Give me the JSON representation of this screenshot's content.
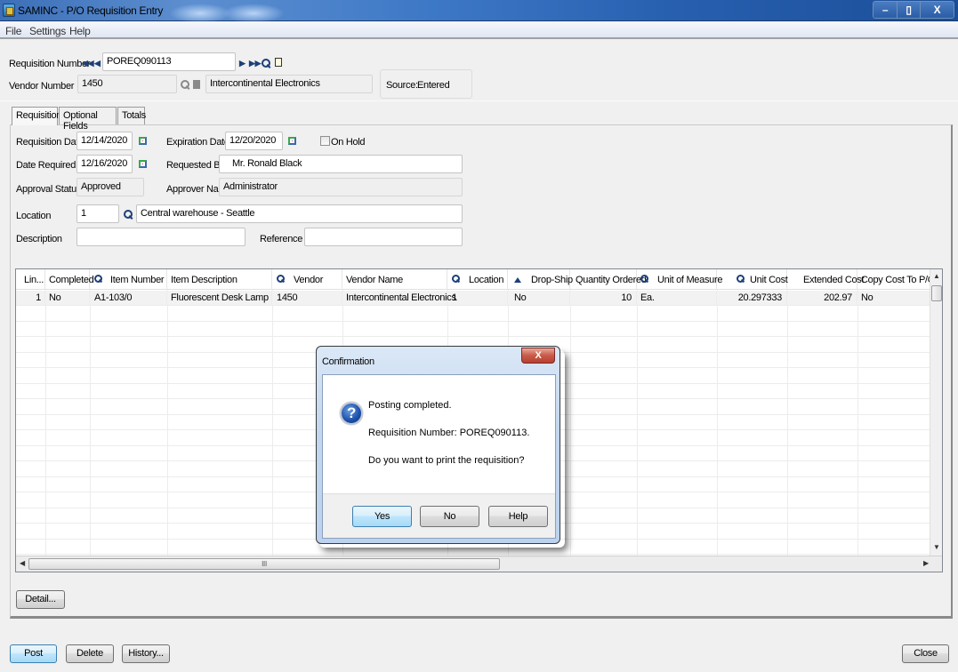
{
  "window": {
    "title": "SAMINC - P/O Requisition Entry",
    "controls": {
      "minimize": "–",
      "restore": "▯",
      "close": "X"
    }
  },
  "menu": [
    "File",
    "Settings",
    "Help"
  ],
  "header": {
    "requisition_number_label": "Requisition Number",
    "requisition_number": "POREQ090113",
    "vendor_number_label": "Vendor Number",
    "vendor_number": "1450",
    "vendor_name": "Intercontinental Electronics",
    "source_label": "Source:",
    "source_value": "Entered"
  },
  "tabs": [
    {
      "label": "Requisition",
      "active": true
    },
    {
      "label": "Optional Fields",
      "active": false
    },
    {
      "label": "Totals",
      "active": false
    }
  ],
  "form": {
    "requisition_date_label": "Requisition Date",
    "requisition_date": "12/14/2020",
    "expiration_date_label": "Expiration Date",
    "expiration_date": "12/20/2020",
    "on_hold_label": "On Hold",
    "on_hold_checked": false,
    "date_required_label": "Date Required",
    "date_required": "12/16/2020",
    "requested_by_label": "Requested By",
    "requested_by": "Mr. Ronald Black",
    "approval_status_label": "Approval Status",
    "approval_status": "Approved",
    "approver_name_label": "Approver Name",
    "approver_name": "Administrator",
    "location_label": "Location",
    "location": "1",
    "location_name": "Central warehouse - Seattle",
    "description_label": "Description",
    "description": "",
    "reference_label": "Reference",
    "reference": ""
  },
  "grid": {
    "columns": [
      "Lin...",
      "Completed",
      "Item Number",
      "Item Description",
      "Vendor",
      "Vendor Name",
      "Location",
      "Drop-Ship",
      "Quantity Ordered",
      "Unit of Measure",
      "Unit Cost",
      "Extended Cost",
      "Copy Cost To P/O"
    ],
    "rows": [
      [
        "1",
        "No",
        "A1-103/0",
        "Fluorescent Desk Lamp",
        "1450",
        "Intercontinental Electronics",
        "1",
        "No",
        "10",
        "Ea.",
        "20.297333",
        "202.97",
        "No"
      ]
    ],
    "hscroll_grip": "III"
  },
  "buttons": {
    "detail": "Detail...",
    "post": "Post",
    "delete": "Delete",
    "history": "History...",
    "close": "Close"
  },
  "dialog": {
    "title": "Confirmation",
    "close": "X",
    "line1": "Posting completed.",
    "line2": "Requisition Number: POREQ090113.",
    "line3": "Do you want to print the requisition?",
    "yes": "Yes",
    "no": "No",
    "help": "Help"
  }
}
